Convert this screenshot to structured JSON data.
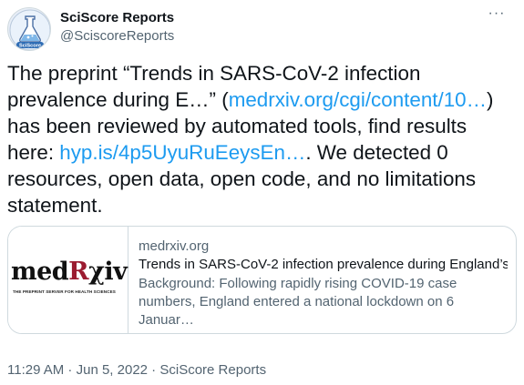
{
  "user": {
    "display_name": "SciScore Reports",
    "handle": "@SciscoreReports",
    "avatar_label": "SciScore",
    "icon": "flask-icon"
  },
  "menu": {
    "more_label": "···",
    "icon": "more-horizontal-icon"
  },
  "tweet": {
    "text_1": "The preprint “Trends in SARS-CoV-2 infection prevalence during E…” (",
    "link_1": "medrxiv.org/cgi/content/10…",
    "text_2": ") has been reviewed by automated tools, find results here: ",
    "link_2": "hyp.is/4p5UyuRuEeysEn…",
    "text_3": ". We detected 0 resources, open data, open code, and no limitations statement."
  },
  "card": {
    "logo_text_prefix": "med",
    "logo_text_r": "R",
    "logo_text_suffix": "χiv",
    "logo_tagline": "THE PREPRINT SERVER FOR HEALTH SCIENCES",
    "domain": "medrxiv.org",
    "title": "Trends in SARS-CoV-2 infection prevalence during England’s…",
    "description_line_1": "Background: Following rapidly rising COVID-19 case",
    "description_line_2": "numbers, England entered a national lockdown on 6 Januar…"
  },
  "meta": {
    "time": "11:29 AM",
    "sep": " · ",
    "date": "Jun 5, 2022",
    "source": "SciScore Reports"
  },
  "colors": {
    "link": "#1d9bf0",
    "text": "#0f1419",
    "secondary": "#536471",
    "border": "#cfd9de",
    "medrxiv_red": "#9b1b30"
  }
}
